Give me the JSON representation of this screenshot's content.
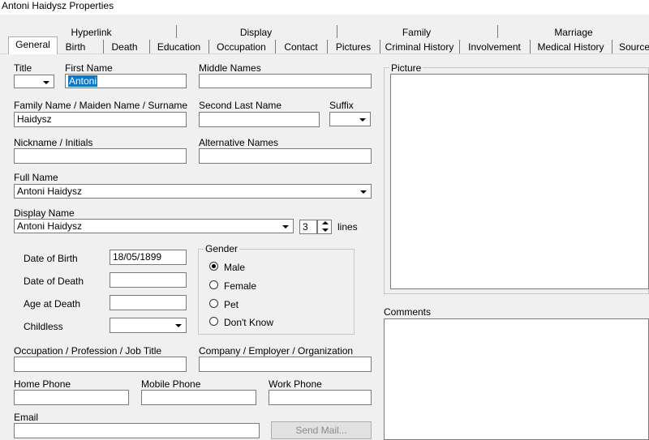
{
  "window": {
    "title": "Antoni Haidysz Properties"
  },
  "tabs_top": [
    "Hyperlink",
    "Display",
    "Family",
    "Marriage"
  ],
  "tabs_bottom": [
    "General",
    "Birth",
    "Death",
    "Education",
    "Occupation",
    "Contact",
    "Pictures",
    "Criminal History",
    "Involvement",
    "Medical History",
    "Source"
  ],
  "active_tab": "General",
  "form": {
    "title_label": "Title",
    "title_value": "",
    "first_name_label": "First Name",
    "first_name_value": "Antoni",
    "middle_names_label": "Middle Names",
    "middle_names_value": "",
    "family_name_label": "Family Name / Maiden Name / Surname",
    "family_name_value": "Haidysz",
    "second_last_name_label": "Second Last Name",
    "second_last_name_value": "",
    "suffix_label": "Suffix",
    "suffix_value": "",
    "nickname_label": "Nickname / Initials",
    "nickname_value": "",
    "alternative_names_label": "Alternative Names",
    "alternative_names_value": "",
    "full_name_label": "Full Name",
    "full_name_value": "Antoni Haidysz",
    "display_name_label": "Display Name",
    "display_name_value": "Antoni Haidysz",
    "display_lines_value": "3",
    "lines_label": "lines",
    "date_of_birth_label": "Date of Birth",
    "date_of_birth_value": "18/05/1899",
    "date_of_death_label": "Date of Death",
    "date_of_death_value": "",
    "age_at_death_label": "Age at Death",
    "age_at_death_value": "",
    "childless_label": "Childless",
    "childless_value": "",
    "gender_label": "Gender",
    "gender_options": [
      "Male",
      "Female",
      "Pet",
      "Don't Know"
    ],
    "gender_selected": "Male",
    "occupation_label": "Occupation / Profession / Job Title",
    "occupation_value": "",
    "company_label": "Company / Employer / Organization",
    "company_value": "",
    "home_phone_label": "Home Phone",
    "home_phone_value": "",
    "mobile_phone_label": "Mobile Phone",
    "mobile_phone_value": "",
    "work_phone_label": "Work Phone",
    "work_phone_value": "",
    "email_label": "Email",
    "email_value": "",
    "send_mail_button": "Send Mail...",
    "picture_label": "Picture",
    "comments_label": "Comments"
  }
}
